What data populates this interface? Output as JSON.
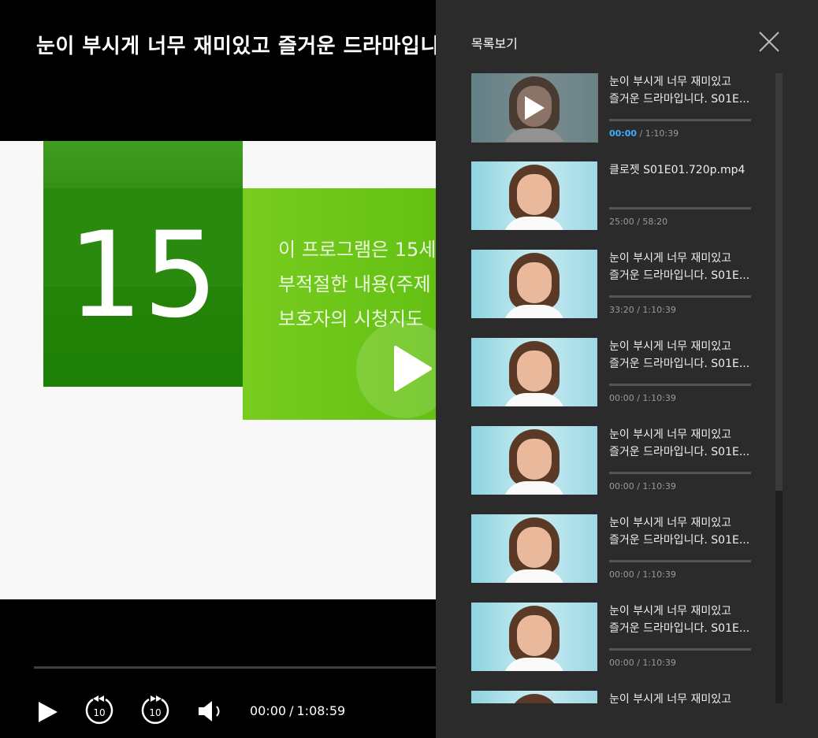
{
  "player": {
    "title": "눈이 부시게 너무 재미있고 즐거운 드라마입니다",
    "video": {
      "rating_number": "15",
      "notice_lines": [
        "이 프로그램은 15세",
        "부적절한 내용(주제",
        "보호자의 시청지도"
      ]
    },
    "progress": 0.0,
    "controls": {
      "play_icon": "play-icon",
      "rewind_label": "10",
      "forward_label": "10",
      "volume_icon": "volume-icon",
      "current_time": "00:00",
      "separator": "/",
      "duration": "1:08:59"
    }
  },
  "panel": {
    "title": "목록보기",
    "close_icon": "close-icon",
    "items": [
      {
        "title_line1": "눈이 부시게 너무 재미있고",
        "title_line2": "즐거운 드라마입니다. S01E...",
        "current": "00:00",
        "separator": " / ",
        "duration": "1:10:39",
        "active": true,
        "progress": 0.0
      },
      {
        "title_line1": "클로젯 S01E01.720p.mp4",
        "title_line2": "",
        "current": "25:00",
        "separator": " / ",
        "duration": "58:20",
        "active": false,
        "progress": 0.0
      },
      {
        "title_line1": "눈이 부시게 너무 재미있고",
        "title_line2": "즐거운 드라마입니다. S01E...",
        "current": "33:20",
        "separator": " / ",
        "duration": "1:10:39",
        "active": false,
        "progress": 0.0
      },
      {
        "title_line1": "눈이 부시게 너무 재미있고",
        "title_line2": "즐거운 드라마입니다. S01E...",
        "current": "00:00",
        "separator": " / ",
        "duration": "1:10:39",
        "active": false,
        "progress": 0.0
      },
      {
        "title_line1": "눈이 부시게 너무 재미있고",
        "title_line2": "즐거운 드라마입니다. S01E...",
        "current": "00:00",
        "separator": " / ",
        "duration": "1:10:39",
        "active": false,
        "progress": 0.0
      },
      {
        "title_line1": "눈이 부시게 너무 재미있고",
        "title_line2": "즐거운 드라마입니다. S01E...",
        "current": "00:00",
        "separator": " / ",
        "duration": "1:10:39",
        "active": false,
        "progress": 0.0
      },
      {
        "title_line1": "눈이 부시게 너무 재미있고",
        "title_line2": "즐거운 드라마입니다. S01E...",
        "current": "00:00",
        "separator": " / ",
        "duration": "1:10:39",
        "active": false,
        "progress": 0.0
      },
      {
        "title_line1": "눈이 부시게 너무 재미있고",
        "title_line2": "",
        "current": "",
        "separator": "",
        "duration": "",
        "active": false,
        "progress": 0.0
      }
    ]
  },
  "colors": {
    "panel_bg": "#2b2b2b",
    "active_time": "#3ab0ff",
    "rating_green": "#2a8a10",
    "notice_green": "#6cc418"
  }
}
